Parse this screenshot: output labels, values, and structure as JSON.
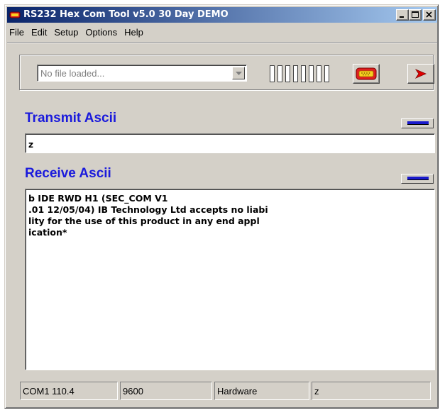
{
  "window": {
    "title": "RS232 Hex Com Tool v5.0 30 Day DEMO"
  },
  "icons": {
    "app": "serial-port-icon",
    "minimize": "minimize-icon",
    "maximize": "maximize-icon",
    "close": "close-icon",
    "dropdown": "chevron-down-icon",
    "bars": "signal-bars-icon",
    "serial": "serial-port-icon",
    "play": "play-arrow-icon",
    "collapse": "collapse-bar-icon"
  },
  "menu": {
    "items": [
      "File",
      "Edit",
      "Setup",
      "Options",
      "Help"
    ]
  },
  "toolbar": {
    "file_combo_placeholder": "No file loaded..."
  },
  "transmit": {
    "heading": "Transmit Ascii",
    "value": "z"
  },
  "receive": {
    "heading": "Receive Ascii",
    "lines": [
      "b IDE RWD H1 (SEC_COM V1",
      ".01 12/05/04) IB Technology Ltd accepts no liabi",
      "lity for the use of this product in any end appl",
      "ication*"
    ]
  },
  "status": {
    "port": "COM1  110.4",
    "baud": "9600",
    "flow": "Hardware",
    "last": "z"
  },
  "colors": {
    "heading": "#1a1adc",
    "title_start": "#0a246a",
    "title_end": "#a6caf0",
    "face": "#d4d0c8"
  }
}
